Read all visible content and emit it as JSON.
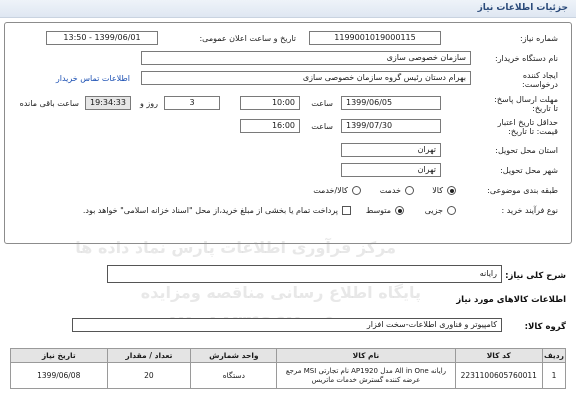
{
  "header": {
    "title": "جزئیات اطلاعات نیاز"
  },
  "form": {
    "need_number_label": "شماره نیاز:",
    "need_number": "1199001019000115",
    "announce_label": "تاریخ و ساعت اعلان عمومی:",
    "announce_value": "1399/06/01 - 13:50",
    "buyer_org_label": "نام دستگاه خریدار:",
    "buyer_org": "سازمان خصوصی سازی",
    "creator_label": "ایجاد کننده درخواست:",
    "creator": "بهرام دستان رئیس گروه سازمان خصوصی سازی",
    "contact_link": "اطلاعات تماس خریدار",
    "reply_deadline_label": "مهلت ارسال پاسخ: تا تاریخ:",
    "reply_date": "1399/06/05",
    "time_label": "ساعت",
    "reply_time": "10:00",
    "days_value": "3",
    "days_label": "روز و",
    "remaining_time": "19:34:33",
    "remaining_label": "ساعت باقی مانده",
    "min_validity_label": "حداقل تاریخ اعتبار قیمت: تا تاریخ:",
    "validity_date": "1399/07/30",
    "time_label2": "ساعت",
    "validity_time": "16:00",
    "province_label": "استان محل تحویل:",
    "province": "تهران",
    "city_label": "شهر محل تحویل:",
    "city": "تهران",
    "category_label": "طبقه بندی موضوعی:",
    "cat_options": [
      "کالا",
      "خدمت",
      "کالا/خدمت"
    ],
    "process_label": "نوع فرآیند خرید :",
    "proc_options": [
      "جزیی",
      "متوسط"
    ],
    "payment_note": "پرداخت تمام یا بخشی از مبلغ خرید،از محل \"اسناد خزانه اسلامی\" خواهد بود."
  },
  "summary": {
    "label": "شرح کلی نیاز:",
    "value": "رایانه"
  },
  "goods": {
    "title": "اطلاعات کالاهای مورد نیاز",
    "group_label": "گروه کالا:",
    "group_value": "کامپیوتر و فناوری اطلاعات-سخت افزار",
    "columns": [
      "ردیف",
      "کد کالا",
      "نام کالا",
      "واحد شمارش",
      "تعداد / مقدار",
      "تاریخ نیاز"
    ],
    "rows": [
      [
        "1",
        "2231100605760011",
        "رایانه All in One مدل AP1920 نام تجارتی MSI مرجع عرضه کننده گسترش خدمات ماتریس",
        "دستگاه",
        "20",
        "1399/06/08"
      ]
    ]
  },
  "watermark": {
    "line1": "مرکز فرآوری اطلاعات پارس نماد داده ها",
    "line2": "پایگاه اطلاع رسانی مناقصه ومزایده",
    "line3": "۰۲۱-۸۸۳۴۹۶۷۰-۵"
  }
}
